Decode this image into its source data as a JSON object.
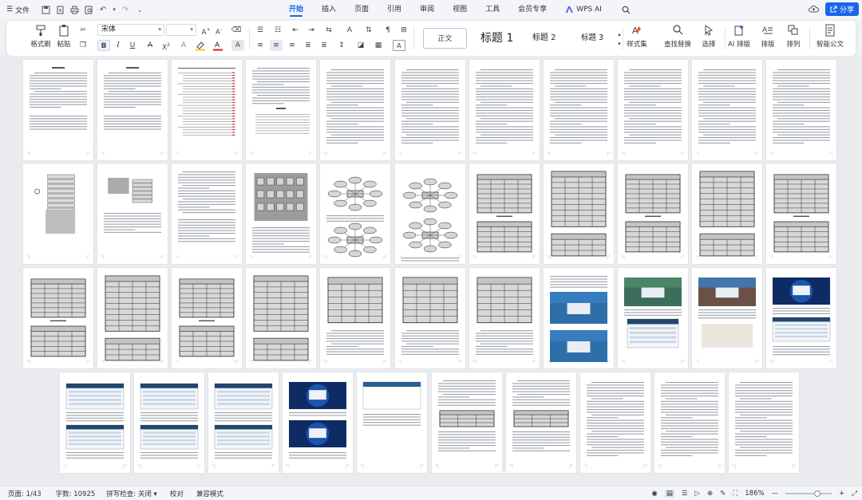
{
  "menu": {
    "file_label": "文件"
  },
  "tabs": [
    {
      "label": "开始",
      "active": true
    },
    {
      "label": "插入"
    },
    {
      "label": "页面"
    },
    {
      "label": "引用"
    },
    {
      "label": "审阅"
    },
    {
      "label": "视图"
    },
    {
      "label": "工具"
    },
    {
      "label": "会员专享"
    },
    {
      "label": "WPS AI"
    }
  ],
  "share_label": "分享",
  "ribbon": {
    "format_painter": "格式刷",
    "paste": "粘贴",
    "font_name": "宋体",
    "font_size": "",
    "bold": "B",
    "italic": "I",
    "styles": {
      "normal": "正文",
      "h": "标题 1",
      "h1": "标题 1",
      "h2": "标题 2",
      "h3": "标题 3"
    },
    "style_set": "样式集",
    "find_replace": "查找替换",
    "select": "选择",
    "ai_layout": "AI 排版",
    "layout": "排版",
    "arrange": "排列",
    "smart_doc": "智能公文"
  },
  "status": {
    "page": "页面: 1/43",
    "words": "字数: 10925",
    "spell": "拼写检查: 关闭",
    "proof": "校对",
    "compat": "兼容模式",
    "zoom": "186%"
  },
  "colors": {
    "accent": "#1a66e8",
    "highlight": "#f6c62a",
    "font_color": "#d42020",
    "screenshot_blue": "#2d6ea8"
  }
}
